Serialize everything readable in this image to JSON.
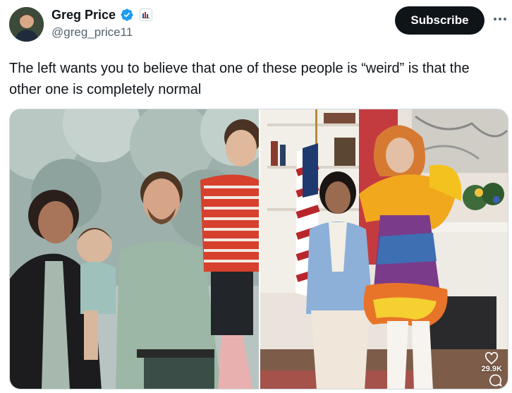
{
  "author": {
    "display_name": "Greg Price",
    "handle": "@greg_price11",
    "verified_color": "#1d9bf0"
  },
  "subscribe_label": "Subscribe",
  "more_icon": "more-dots-icon",
  "tweet_text": "The left wants you to believe that one of these people is “weird” is that the other one is completely normal",
  "media": {
    "left_photo": "family-photo",
    "right_photo": "kamala-with-drag-performer-photo",
    "like_count": "29.9K",
    "icons": [
      "heart-icon",
      "comment-icon"
    ]
  }
}
